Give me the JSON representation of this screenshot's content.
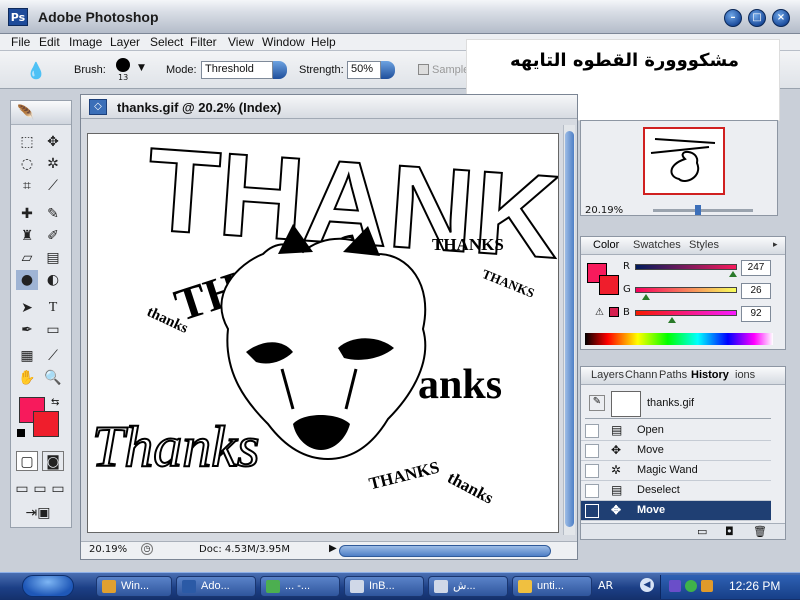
{
  "window": {
    "title": "Adobe Photoshop"
  },
  "menu": [
    "File",
    "Edit",
    "Image",
    "Layer",
    "Select",
    "Filter",
    "View",
    "Window",
    "Help"
  ],
  "options": {
    "brush_label": "Brush:",
    "brush_size": "13",
    "mode_label": "Mode:",
    "mode_value": "Threshold",
    "strength_label": "Strength:",
    "strength_value": "50%",
    "sample_label": "Sample"
  },
  "note": {
    "text": "مشكووورة القطوه التايهه"
  },
  "document": {
    "title": "thanks.gif @ 20.2% (Index)",
    "zoom": "20.19%",
    "doc_size": "Doc: 4.53M/3.95M"
  },
  "canvas_text": {
    "thanks_big_outline": "THANKS",
    "thanks_bold": "THANKS",
    "thanks_outline_right": "THANKS",
    "thanks_small_r": "THANKS",
    "thanks_lower_l": "thanks",
    "anks": "anks",
    "thanks_script": "Thanks",
    "thanks_bottom_caps": "THANKS",
    "thanks_bottom_lower": "thanks"
  },
  "navigator": {
    "zoom": "20.19%"
  },
  "color_panel": {
    "tabs": [
      "Color",
      "Swatches",
      "Styles"
    ],
    "channels": [
      {
        "label": "R",
        "value": "247"
      },
      {
        "label": "G",
        "value": "26"
      },
      {
        "label": "B",
        "value": "92"
      }
    ],
    "foreground": "#f71a5c",
    "background": "#ef1e2c"
  },
  "history_panel": {
    "tabs": [
      "Layers",
      "Chann",
      "Paths",
      "History",
      "ions"
    ],
    "snapshot": "thanks.gif",
    "items": [
      "Open",
      "Move",
      "Magic Wand",
      "Deselect",
      "Move"
    ]
  },
  "taskbar": {
    "items": [
      "Win...",
      "Ado...",
      "... -...",
      "InB...",
      "ش...",
      "unti..."
    ],
    "lang": "AR",
    "clock": "12:26 PM"
  }
}
